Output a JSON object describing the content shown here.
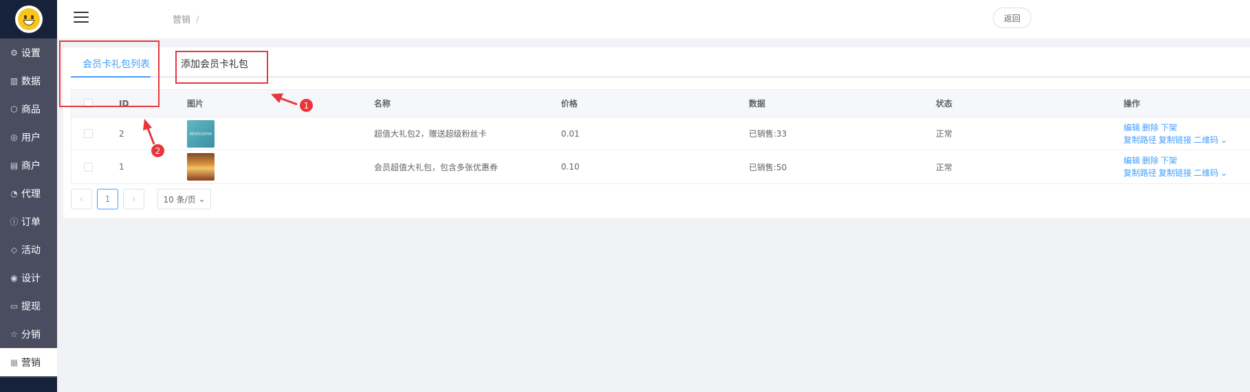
{
  "sidebar": {
    "items": [
      {
        "label": "设置",
        "icon": "gear-icon",
        "glyph": "⚙"
      },
      {
        "label": "数据",
        "icon": "bar-chart-icon",
        "glyph": "▥"
      },
      {
        "label": "商品",
        "icon": "box-icon",
        "glyph": "⬡"
      },
      {
        "label": "用户",
        "icon": "user-icon",
        "glyph": "◎"
      },
      {
        "label": "商户",
        "icon": "store-icon",
        "glyph": "▤"
      },
      {
        "label": "代理",
        "icon": "pie-icon",
        "glyph": "◔"
      },
      {
        "label": "订单",
        "icon": "info-icon",
        "glyph": "ⓘ"
      },
      {
        "label": "活动",
        "icon": "tag-icon",
        "glyph": "◇"
      },
      {
        "label": "设计",
        "icon": "palette-icon",
        "glyph": "◉"
      },
      {
        "label": "提现",
        "icon": "card-icon",
        "glyph": "▭"
      },
      {
        "label": "分销",
        "icon": "star-icon",
        "glyph": "☆"
      },
      {
        "label": "营销",
        "icon": "grid-icon",
        "glyph": "▦"
      }
    ],
    "active_index": 11
  },
  "header": {
    "breadcrumb": "营销",
    "breadcrumb_sep": "/",
    "back_label": "返回"
  },
  "tabs": [
    {
      "label": "会员卡礼包列表"
    },
    {
      "label": "添加会员卡礼包"
    }
  ],
  "table": {
    "headers": {
      "id": "ID",
      "image": "图片",
      "name": "名称",
      "price": "价格",
      "data": "数据",
      "status": "状态",
      "ops": "操作"
    },
    "rows": [
      {
        "id": "2",
        "image_text": "Welcome",
        "name": "超值大礼包2，赠送超级粉丝卡",
        "price": "0.01",
        "data": "已销售:33",
        "status": "正常",
        "ops1": [
          "编辑",
          "删除",
          "下架"
        ],
        "ops2": [
          "复制路径",
          "复制链接",
          "二维码"
        ]
      },
      {
        "id": "1",
        "name": "会员超值大礼包，包含多张优惠券",
        "price": "0.10",
        "data": "已销售:50",
        "status": "正常",
        "ops1": [
          "编辑",
          "删除",
          "下架"
        ],
        "ops2": [
          "复制路径",
          "复制链接",
          "二维码"
        ]
      }
    ]
  },
  "pagination": {
    "current_page": "1",
    "page_size": "10 条/页"
  },
  "annotations": {
    "label_1": "1",
    "label_2": "2"
  },
  "colors": {
    "accent": "#409eff",
    "sidebar": "#4a4d60",
    "annotation": "#e8363a"
  }
}
